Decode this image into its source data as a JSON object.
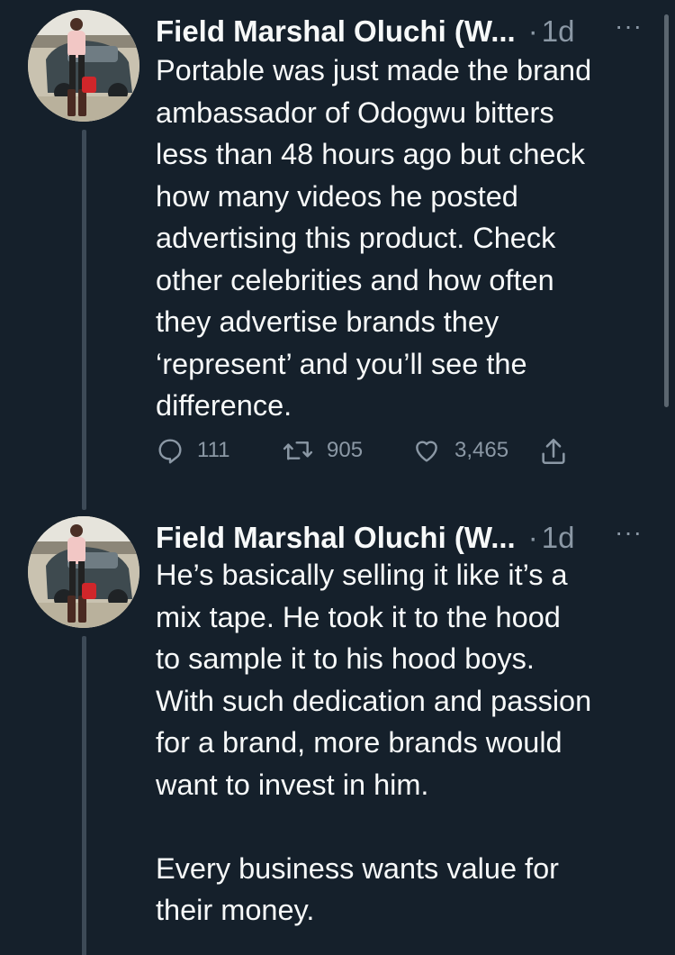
{
  "tweets": [
    {
      "author_name": "Field Marshal Oluchi (W...",
      "separator": "·",
      "time": "1d",
      "more_label": "···",
      "text": "Portable was just made the brand\nambassador of Odogwu bitters\nless than 48 hours ago but check\nhow many videos he posted\nadvertising this product. Check\nother celebrities and how often\nthey advertise brands they\n‘represent’ and you’ll see the\ndifference.",
      "replies": "111",
      "retweets": "905",
      "likes": "3,465"
    },
    {
      "author_name": "Field Marshal Oluchi (W...",
      "separator": "·",
      "time": "1d",
      "more_label": "···",
      "text": "He’s basically selling it like it’s a\nmix tape. He took it to the hood\nto sample it to his hood boys.\nWith such dedication and passion\nfor a brand, more brands would\nwant to invest in him.\n\nEvery business wants value for\ntheir money."
    }
  ],
  "icons": {
    "reply": "reply-icon",
    "retweet": "retweet-icon",
    "like": "like-icon",
    "share": "share-icon"
  },
  "colors": {
    "background": "#15202b",
    "primary_text": "#f7f9f9",
    "secondary_text": "#8b98a5"
  }
}
